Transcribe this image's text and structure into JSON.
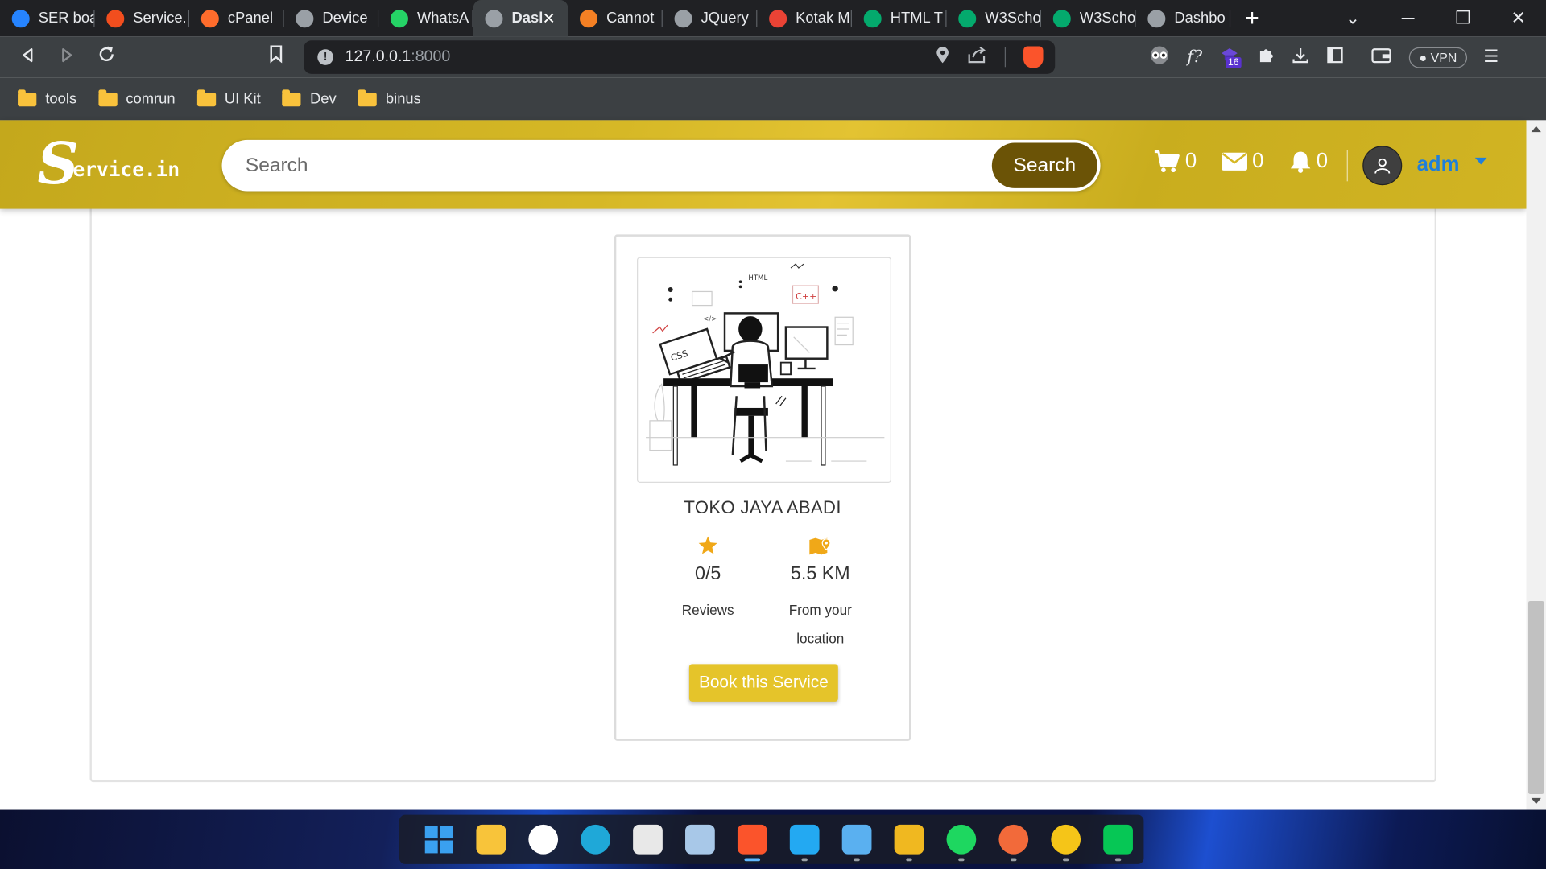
{
  "browser": {
    "tabs": [
      {
        "title": "SER boa",
        "icon": "jira-icon",
        "color": "#2684ff"
      },
      {
        "title": "Service.",
        "icon": "figma-icon",
        "color": "#f24e1e"
      },
      {
        "title": "cPanel",
        "icon": "cpanel-icon",
        "color": "#ff6c2c"
      },
      {
        "title": "Device",
        "icon": "globe-icon",
        "color": "#9aa0a6"
      },
      {
        "title": "WhatsA",
        "icon": "whatsapp-icon",
        "color": "#25d366"
      },
      {
        "title": "Dasl",
        "icon": "globe-icon",
        "color": "#9aa0a6",
        "active": true
      },
      {
        "title": "Cannot",
        "icon": "stackoverflow-icon",
        "color": "#f48024"
      },
      {
        "title": "JQuery",
        "icon": "globe-icon",
        "color": "#9aa0a6"
      },
      {
        "title": "Kotak M",
        "icon": "gmail-icon",
        "color": "#ea4335"
      },
      {
        "title": "HTML T",
        "icon": "w3schools-icon",
        "color": "#04aa6d"
      },
      {
        "title": "W3Scho",
        "icon": "w3schools-icon",
        "color": "#04aa6d"
      },
      {
        "title": "W3Scho",
        "icon": "w3schools-icon",
        "color": "#04aa6d"
      },
      {
        "title": "Dashbo",
        "icon": "globe-icon",
        "color": "#9aa0a6"
      }
    ],
    "url_host": "127.0.0.1",
    "url_port": ":8000",
    "ext_badge": "16",
    "vpn_label": "VPN",
    "bookmarks": [
      "tools",
      "comrun",
      "UI Kit",
      "Dev",
      "binus"
    ]
  },
  "header": {
    "logo_s": "S",
    "logo_rest": "ervice.in",
    "search_placeholder": "Search",
    "search_button": "Search",
    "cart_count": "0",
    "mail_count": "0",
    "notif_count": "0",
    "username": "adm",
    "brand_color": "#d6b826",
    "link_color": "#1f7fdb"
  },
  "card": {
    "shop_name": "TOKO JAYA ABADI",
    "rating_value": "0/5",
    "rating_label": "Reviews",
    "distance_value": "5.5 KM",
    "distance_label": "From your location",
    "book_button": "Book this Service",
    "illus_text": {
      "html": "HTML",
      "css": "CSS",
      "cpp": "C++",
      "code": "</>"
    },
    "accent_color": "#e5c42a",
    "icon_color": "#f0a818"
  },
  "taskbar": {
    "apps": [
      {
        "name": "windows-start-icon",
        "color": "#3aa0f0"
      },
      {
        "name": "file-explorer-icon",
        "color": "#f8c43a"
      },
      {
        "name": "xbox-icon",
        "color": "#ffffff"
      },
      {
        "name": "edge-icon",
        "color": "#1fa8d8"
      },
      {
        "name": "microsoft-store-icon",
        "color": "#e8e8e8"
      },
      {
        "name": "photos-icon",
        "color": "#a8c8e8"
      },
      {
        "name": "brave-browser-icon",
        "color": "#fb542b",
        "active": true
      },
      {
        "name": "vscode-icon",
        "color": "#23a9f2"
      },
      {
        "name": "notepad-icon",
        "color": "#5ab0f0"
      },
      {
        "name": "figma-like-icon",
        "color": "#f0b820"
      },
      {
        "name": "spotify-icon",
        "color": "#1ed760"
      },
      {
        "name": "app-orange-icon",
        "color": "#f26a3a"
      },
      {
        "name": "download-manager-icon",
        "color": "#f5c518"
      },
      {
        "name": "line-icon",
        "color": "#06c755"
      }
    ]
  }
}
